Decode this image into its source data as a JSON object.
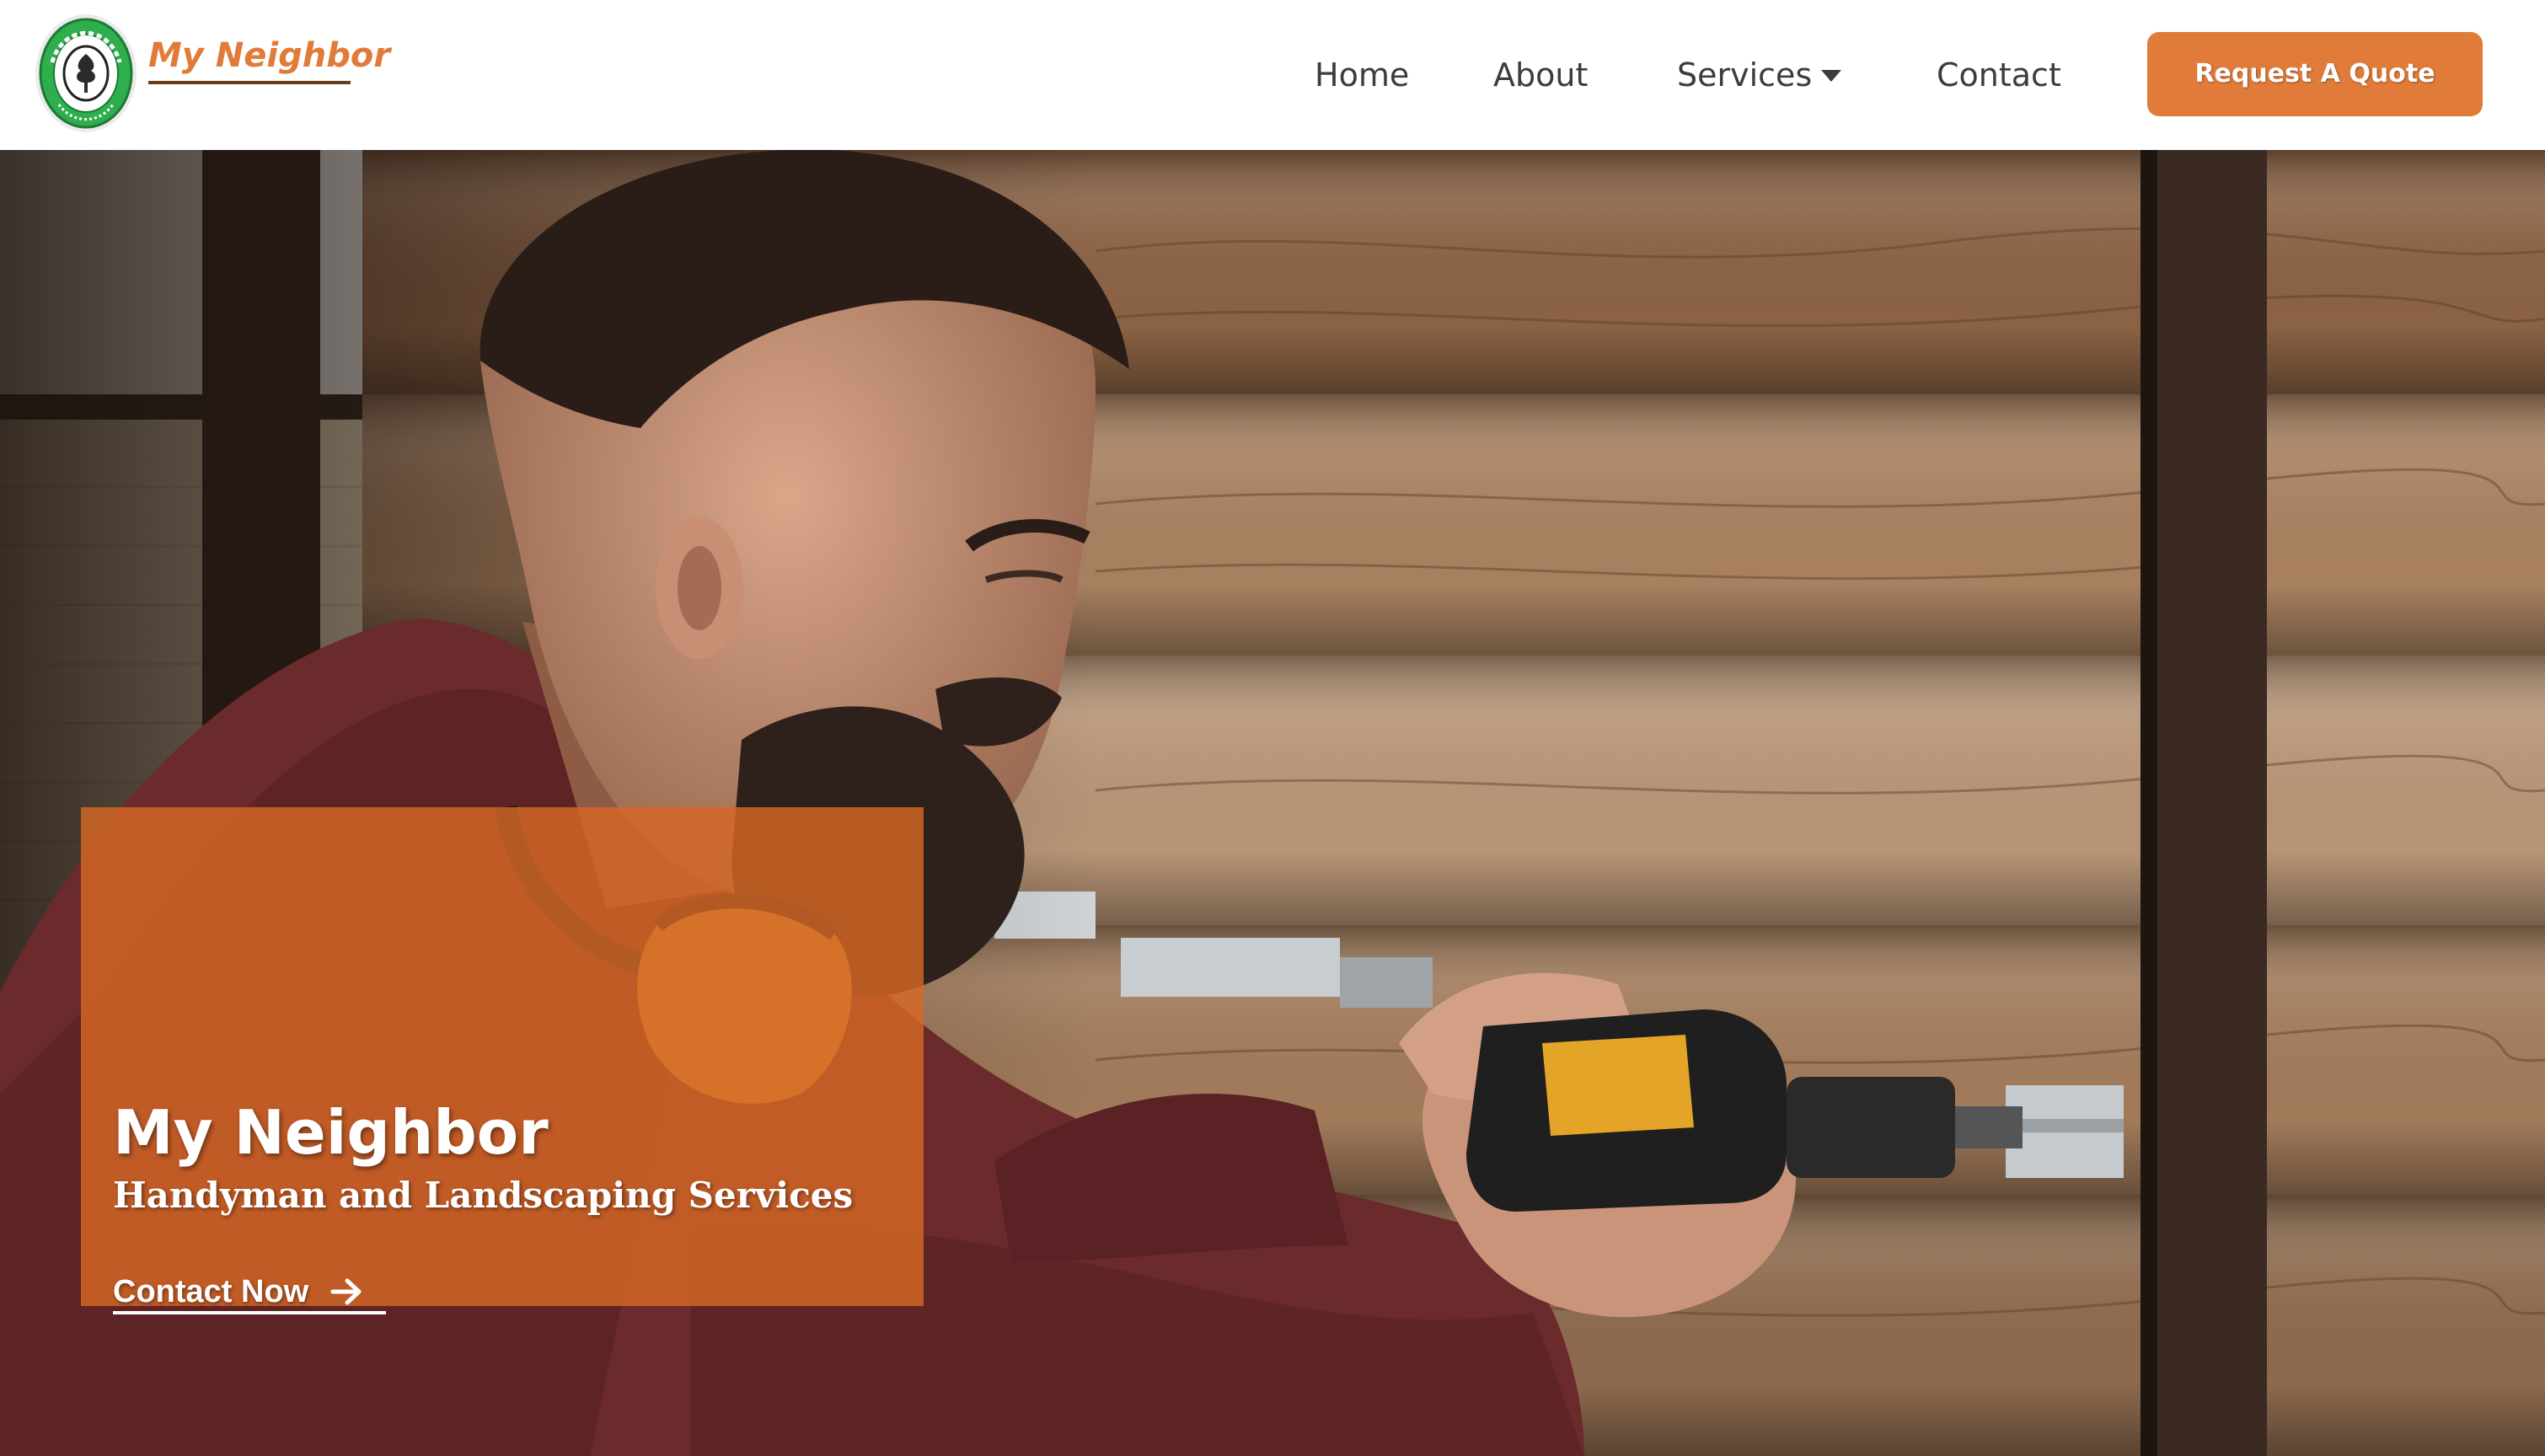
{
  "brand": {
    "name": "My Neighbor",
    "logo_icon": "tree-badge-icon",
    "logo_badge_text": "MY NEIGHBOR",
    "accent_color": "#e07b39",
    "badge_green": "#2fae4e"
  },
  "nav": {
    "items": [
      {
        "label": "Home"
      },
      {
        "label": "About"
      },
      {
        "label": "Services"
      },
      {
        "label": "Contact"
      }
    ],
    "services_dropdown_icon": "caret-down-icon",
    "cta_label": "Request A Quote",
    "cta_color": "#e07b39"
  },
  "hero": {
    "background_image": "handyman-drilling-log-wall-photo",
    "overlay_color": "#d66826",
    "title": "My Neighbor",
    "subtitle": "Handyman and Landscaping Services",
    "link_label": "Contact Now",
    "link_icon": "arrow-right-icon"
  }
}
